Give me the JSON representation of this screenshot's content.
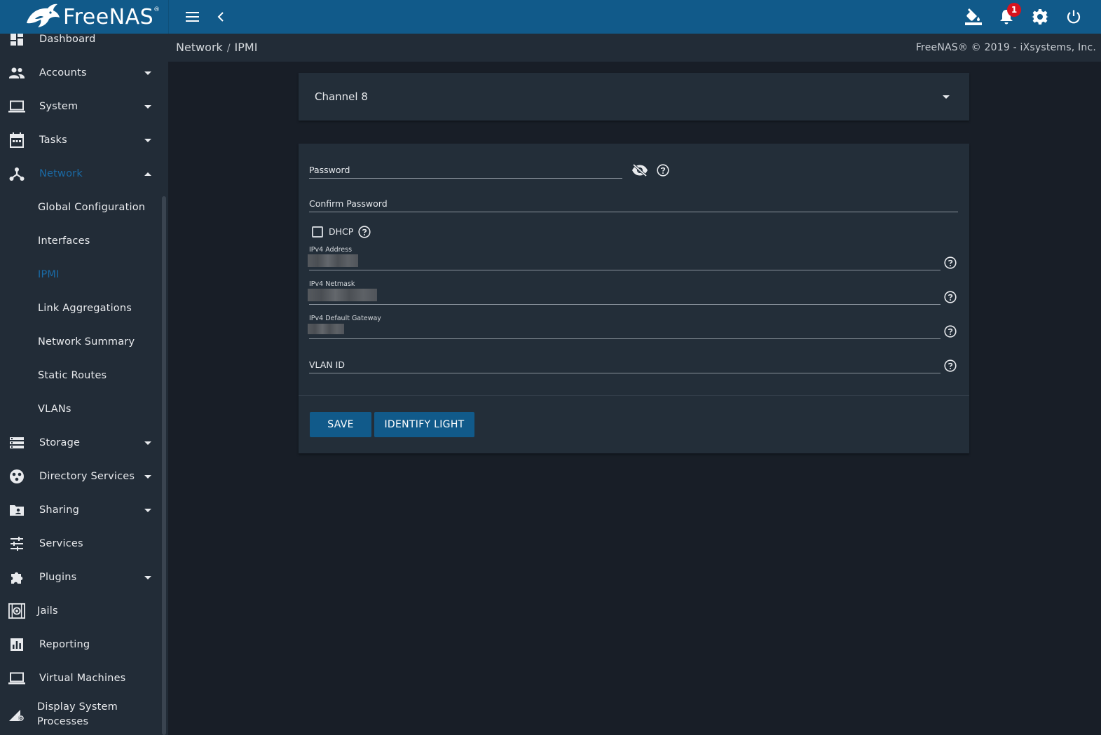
{
  "app": {
    "logo_text": "FreeNAS",
    "logo_mark": "®"
  },
  "topbar": {
    "notification_count": "1",
    "icons": [
      "menu-icon",
      "chevron-left-icon",
      "theme-paint-icon",
      "bell-icon",
      "gear-icon",
      "power-icon"
    ]
  },
  "sidebar": {
    "items": [
      {
        "label": "Dashboard",
        "icon": "dashboard-icon"
      },
      {
        "label": "Accounts",
        "icon": "people-icon"
      },
      {
        "label": "System",
        "icon": "laptop-icon"
      },
      {
        "label": "Tasks",
        "icon": "calendar-icon"
      },
      {
        "label": "Network",
        "icon": "network-icon"
      },
      {
        "label": "Global Configuration"
      },
      {
        "label": "Interfaces"
      },
      {
        "label": "IPMI"
      },
      {
        "label": "Link Aggregations"
      },
      {
        "label": "Network Summary"
      },
      {
        "label": "Static Routes"
      },
      {
        "label": "VLANs"
      },
      {
        "label": "Storage",
        "icon": "storage-icon"
      },
      {
        "label": "Directory Services",
        "icon": "directory-icon"
      },
      {
        "label": "Sharing",
        "icon": "folder-share-icon"
      },
      {
        "label": "Services",
        "icon": "tune-icon"
      },
      {
        "label": "Plugins",
        "icon": "puzzle-icon"
      },
      {
        "label": "Jails",
        "icon": "jail-icon"
      },
      {
        "label": "Reporting",
        "icon": "chart-icon"
      },
      {
        "label": "Virtual Machines",
        "icon": "laptop-icon"
      },
      {
        "label": "Display System Processes",
        "icon": "processes-icon"
      }
    ],
    "accent_color": "#1a6aa5"
  },
  "breadcrumb": {
    "parent": "Network",
    "separator": "/",
    "current": "IPMI"
  },
  "copyright": "FreeNAS® © 2019 - iXsystems, Inc.",
  "channel_select": {
    "value": "Channel 8"
  },
  "form": {
    "password_label": "Password",
    "confirm_password_label": "Confirm Password",
    "dhcp_label": "DHCP",
    "ipv4_address_label": "IPv4 Address",
    "ipv4_netmask_label": "IPv4 Netmask",
    "ipv4_gateway_label": "IPv4 Default Gateway",
    "vlan_id_label": "VLAN ID"
  },
  "buttons": {
    "save": "SAVE",
    "identify_light": "IDENTIFY LIGHT"
  },
  "colors": {
    "topbar": "#115a8a",
    "background": "#181e27",
    "card": "#232e39",
    "button": "#115a8a",
    "badge": "#d9131e"
  }
}
